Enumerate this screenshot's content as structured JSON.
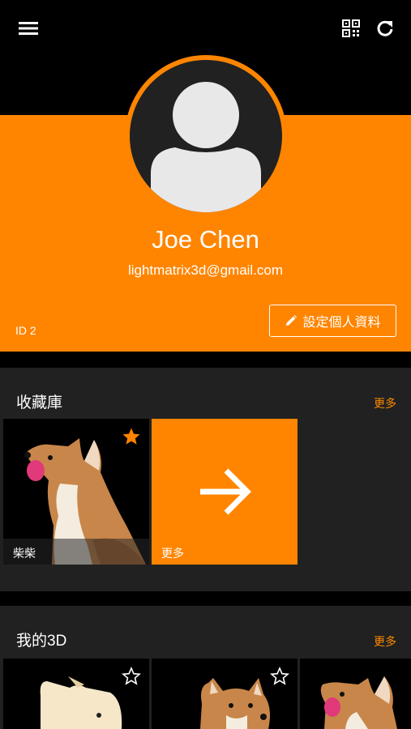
{
  "header": {
    "menu_icon": "menu-icon",
    "qr_icon": "qr-code-icon",
    "refresh_icon": "refresh-icon"
  },
  "profile": {
    "name": "Joe Chen",
    "email": "lightmatrix3d@gmail.com",
    "id_label": "ID 2",
    "edit_button": "設定個人資料",
    "accent_color": "#ff8500"
  },
  "collection": {
    "title": "收藏庫",
    "more_label": "更多",
    "items": [
      {
        "caption": "柴柴",
        "favorited": true
      },
      {
        "caption": "更多"
      }
    ]
  },
  "my3d": {
    "title": "我的3D",
    "more_label": "更多",
    "items": [
      {
        "favorited": false
      },
      {
        "favorited": false
      },
      {
        "favorited": false
      }
    ]
  }
}
